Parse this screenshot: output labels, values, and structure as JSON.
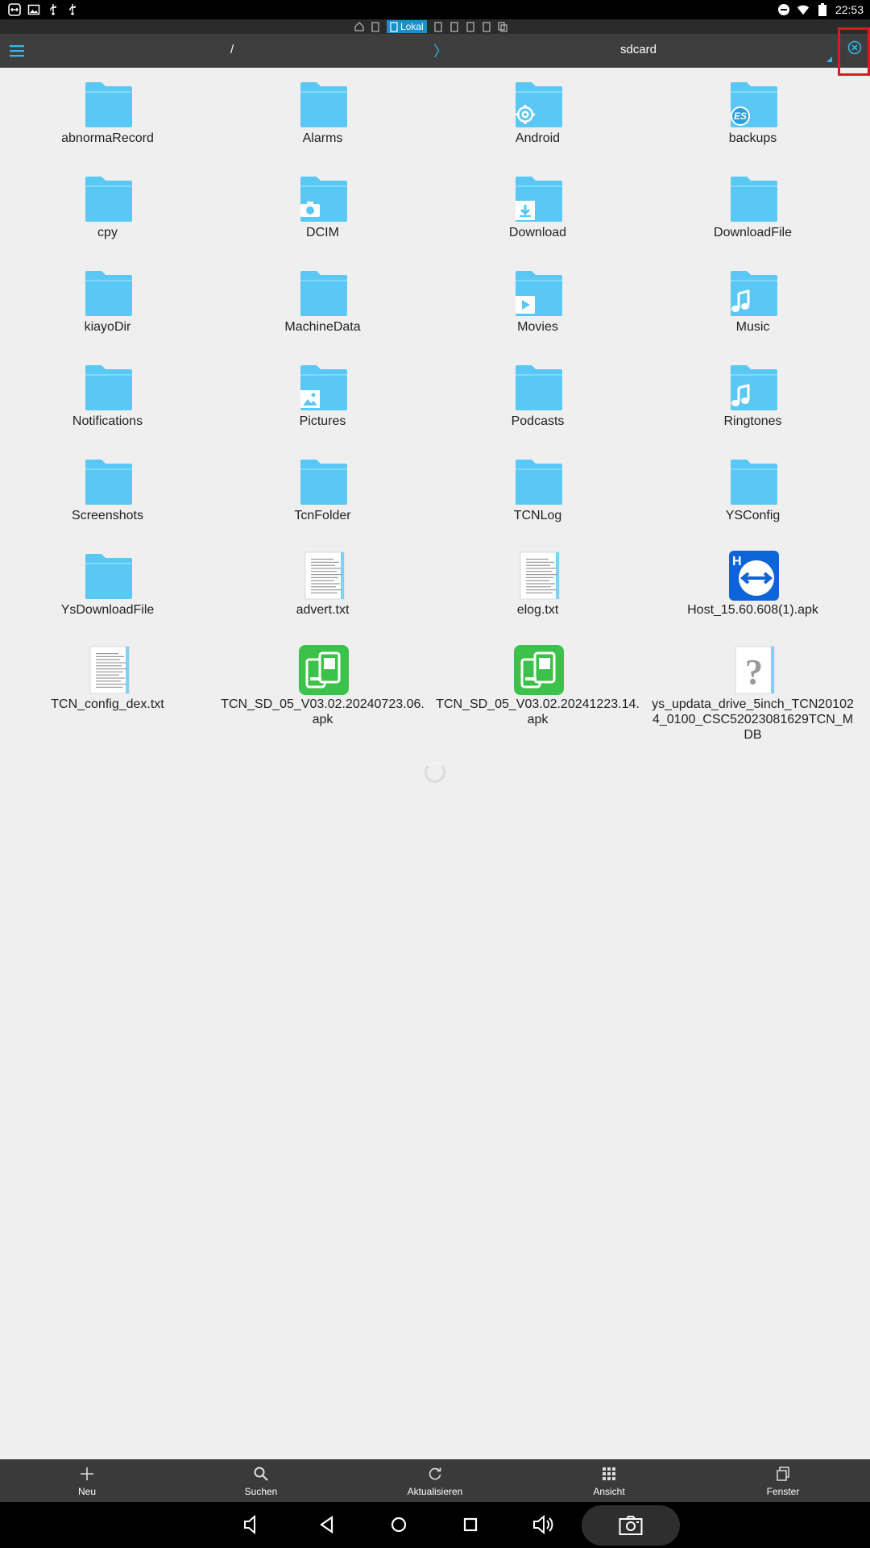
{
  "status_bar": {
    "time": "22:53",
    "left_icons": [
      "teamviewer-icon",
      "image-icon",
      "usb-icon",
      "usb-icon"
    ],
    "right_icons": [
      "do-not-disturb-icon",
      "wifi-icon",
      "battery-icon"
    ]
  },
  "window_strip": {
    "active_label": "Lokal"
  },
  "toolbar": {
    "path_root": "/",
    "path_separator": "〉",
    "path_current": "sdcard"
  },
  "files": [
    {
      "name": "abnormaRecord",
      "type": "folder"
    },
    {
      "name": "Alarms",
      "type": "folder"
    },
    {
      "name": "Android",
      "type": "folder-settings"
    },
    {
      "name": "backups",
      "type": "folder-es"
    },
    {
      "name": "cpy",
      "type": "folder"
    },
    {
      "name": "DCIM",
      "type": "folder-camera"
    },
    {
      "name": "Download",
      "type": "folder-download"
    },
    {
      "name": "DownloadFile",
      "type": "folder"
    },
    {
      "name": "kiayoDir",
      "type": "folder"
    },
    {
      "name": "MachineData",
      "type": "folder"
    },
    {
      "name": "Movies",
      "type": "folder-video"
    },
    {
      "name": "Music",
      "type": "folder-music"
    },
    {
      "name": "Notifications",
      "type": "folder"
    },
    {
      "name": "Pictures",
      "type": "folder-picture"
    },
    {
      "name": "Podcasts",
      "type": "folder"
    },
    {
      "name": "Ringtones",
      "type": "folder-music"
    },
    {
      "name": "Screenshots",
      "type": "folder"
    },
    {
      "name": "TcnFolder",
      "type": "folder"
    },
    {
      "name": "TCNLog",
      "type": "folder"
    },
    {
      "name": "YSConfig",
      "type": "folder"
    },
    {
      "name": "YsDownloadFile",
      "type": "folder"
    },
    {
      "name": "advert.txt",
      "type": "text"
    },
    {
      "name": "elog.txt",
      "type": "text"
    },
    {
      "name": "Host_15.60.608(1).apk",
      "type": "apk-teamviewer"
    },
    {
      "name": "TCN_config_dex.txt",
      "type": "text"
    },
    {
      "name": "TCN_SD_05_V03.02.20240723.06.apk",
      "type": "apk-green"
    },
    {
      "name": "TCN_SD_05_V03.02.20241223.14.apk",
      "type": "apk-green"
    },
    {
      "name": "ys_updata_drive_5inch_TCN201024_0100_CSC52023081629TCN_MDB",
      "type": "unknown"
    }
  ],
  "bottom_bar": [
    {
      "label": "Neu",
      "icon": "plus-icon"
    },
    {
      "label": "Suchen",
      "icon": "search-icon"
    },
    {
      "label": "Aktualisieren",
      "icon": "refresh-icon"
    },
    {
      "label": "Ansicht",
      "icon": "grid-view-icon"
    },
    {
      "label": "Fenster",
      "icon": "windows-icon"
    }
  ],
  "colors": {
    "folder": "#5ac8f5",
    "accent": "#33b5e5",
    "toolbar": "#3e3e3e",
    "highlight": "#e0191f"
  }
}
